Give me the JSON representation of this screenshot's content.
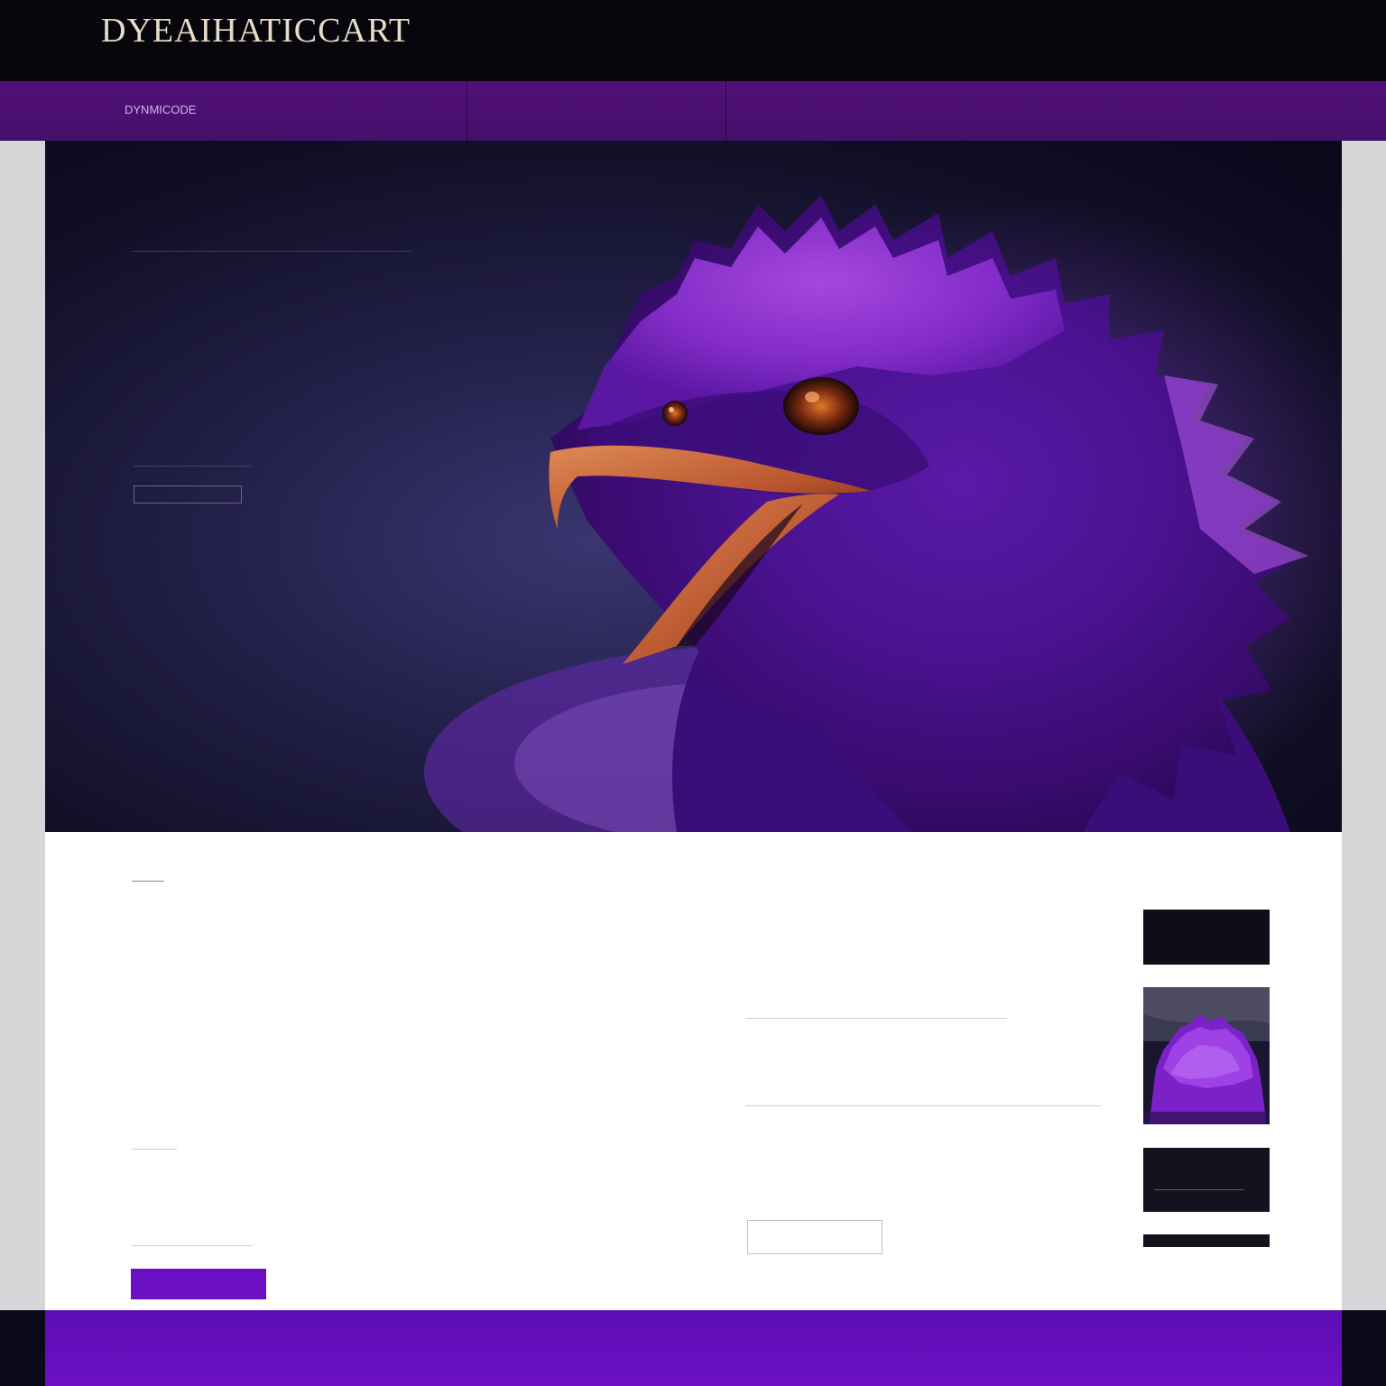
{
  "header": {
    "logo": "DYEAIHATICCART",
    "utility_links": [
      "",
      "",
      "",
      "",
      "",
      ""
    ]
  },
  "nav": {
    "items": [
      "DYNMICODE",
      "",
      "",
      "",
      "",
      "",
      "",
      "",
      ""
    ]
  },
  "hero": {
    "kicker": "",
    "title": "",
    "small": "",
    "subtitle": "",
    "paragraph": "",
    "button": ""
  },
  "content": {
    "col1": {
      "title": "",
      "subtitle": "",
      "para1": "",
      "heading2": "",
      "para2": "",
      "button": ""
    },
    "col2": {
      "title": "",
      "kicker": "",
      "heading": "",
      "para1": "",
      "para2": "",
      "note": "",
      "button": ""
    }
  },
  "sidebar": {
    "title": "",
    "subtitle": "",
    "card1_text": "",
    "card3_text": ""
  },
  "colors": {
    "nav_purple": "#521079",
    "primary_purple": "#6a0fc2",
    "header_black": "#07060d",
    "hero_gold": "#c39c62"
  },
  "icons": [
    "purple-bird-illustration"
  ]
}
